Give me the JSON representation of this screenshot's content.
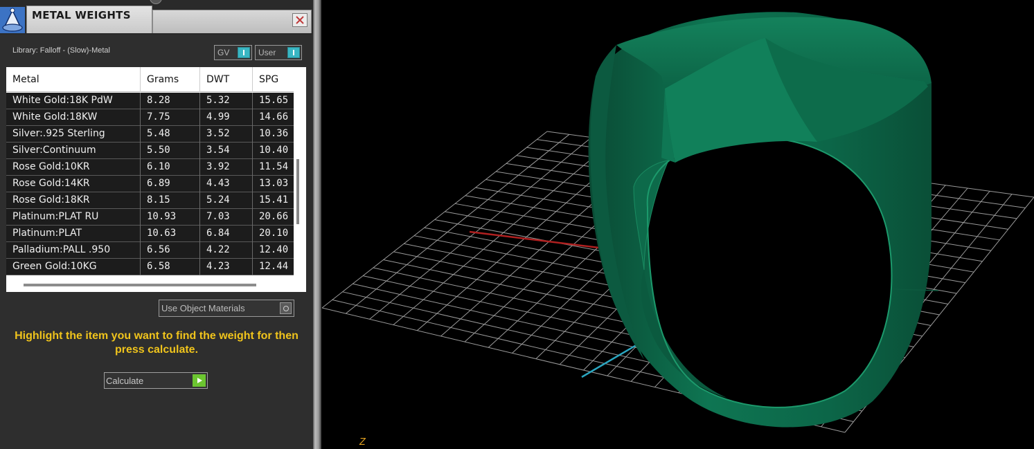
{
  "window": {
    "title": "METAL WEIGHTS",
    "close_icon": "close-icon"
  },
  "library": {
    "label": "Library: Falloff - (Slow)-Metal"
  },
  "toggles": {
    "gv_label": "GV",
    "user_label": "User"
  },
  "table": {
    "headers": [
      "Metal",
      "Grams",
      "DWT",
      "SPG"
    ],
    "rows": [
      {
        "metal": "White Gold:18K PdW",
        "grams": "8.28",
        "dwt": "5.32",
        "spg": "15.65"
      },
      {
        "metal": "White Gold:18KW",
        "grams": "7.75",
        "dwt": "4.99",
        "spg": "14.66"
      },
      {
        "metal": "Silver:.925 Sterling",
        "grams": "5.48",
        "dwt": "3.52",
        "spg": "10.36"
      },
      {
        "metal": "Silver:Continuum",
        "grams": "5.50",
        "dwt": "3.54",
        "spg": "10.40"
      },
      {
        "metal": "Rose Gold:10KR",
        "grams": "6.10",
        "dwt": "3.92",
        "spg": "11.54"
      },
      {
        "metal": "Rose Gold:14KR",
        "grams": "6.89",
        "dwt": "4.43",
        "spg": "13.03"
      },
      {
        "metal": "Rose Gold:18KR",
        "grams": "8.15",
        "dwt": "5.24",
        "spg": "15.41"
      },
      {
        "metal": "Platinum:PLAT RU",
        "grams": "10.93",
        "dwt": "7.03",
        "spg": "20.66"
      },
      {
        "metal": "Platinum:PLAT",
        "grams": "10.63",
        "dwt": "6.84",
        "spg": "20.10"
      },
      {
        "metal": "Palladium:PALL .950",
        "grams": "6.56",
        "dwt": "4.22",
        "spg": "12.40"
      },
      {
        "metal": "Green Gold:10KG",
        "grams": "6.58",
        "dwt": "4.23",
        "spg": "12.44"
      }
    ]
  },
  "use_object_materials": {
    "label": "Use Object Materials"
  },
  "instructions": "Highlight the item you want to find the weight for then press calculate.",
  "calculate": {
    "label": "Calculate",
    "icon": "play-icon"
  },
  "viewport": {
    "axis_label": "Z",
    "object_color": "#0f6e4e",
    "x_axis_color": "#b02020",
    "y_axis_color": "#2aa6c0"
  }
}
